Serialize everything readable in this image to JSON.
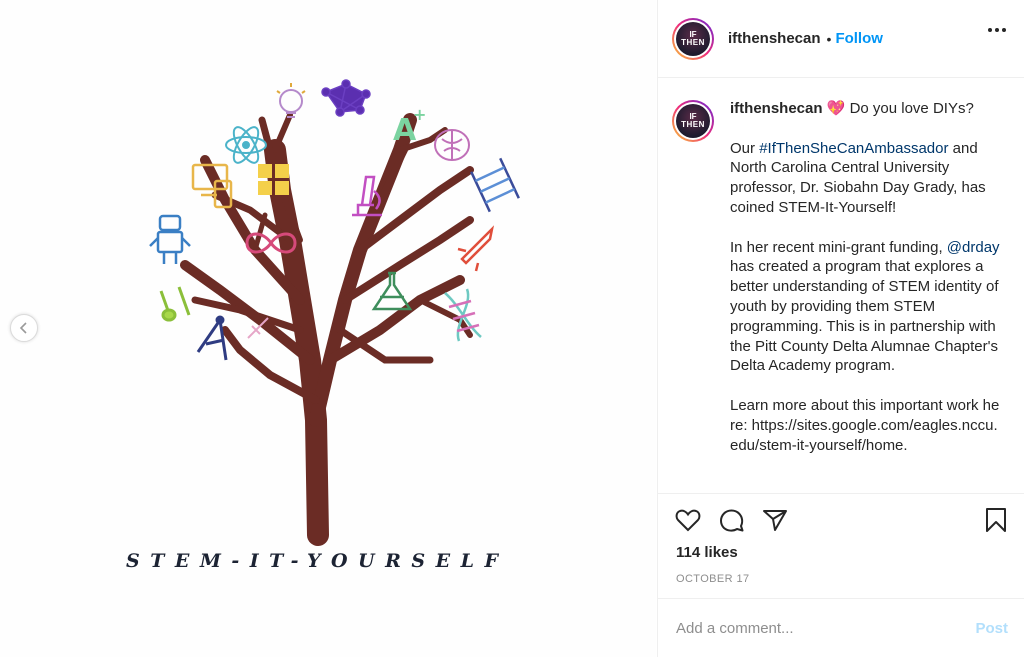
{
  "media": {
    "artwork_title": "STEM-IT-YOURSELF",
    "prev_icon": "chevron-left-icon",
    "icons": [
      "lightbulb-icon",
      "network-icon",
      "a-plus-icon",
      "brain-icon",
      "atom-icon",
      "devices-icon",
      "microscope-icon",
      "abacus-icon",
      "robot-icon",
      "infinity-icon",
      "rocket-icon",
      "flask-icon",
      "test-tubes-icon",
      "compass-icon",
      "dna-icon"
    ],
    "colors": {
      "trunk": "#6b2c25",
      "title": "#1c2333"
    }
  },
  "header": {
    "username": "ifthenshecan",
    "separator": "•",
    "follow_label": "Follow",
    "avatar_line1": "IF",
    "avatar_line2": "THEN",
    "more_icon": "more-horizontal-icon"
  },
  "post": {
    "username": "ifthenshecan",
    "emoji": "💖",
    "line1": "Do you love DIYs?",
    "p1_prefix": "Our ",
    "hashtag": "#IfThenSheCanAmbassador",
    "p1_suffix": " and North Carolina Central University professor, Dr. Siobahn Day Grady, has coined STEM-It-Yourself!",
    "p2_prefix": "In her recent mini-grant funding, ",
    "mention": "@drday",
    "p2_suffix": " has created a program that explores a better understanding of STEM identity of youth by providing them STEM programming. This is in partnership with the Pitt County Delta Alumnae Chapter's Delta Academy program.",
    "p3": "Learn more about this important work here: https://sites.google.com/eagles.nccu.edu/stem-it-yourself/home."
  },
  "actions": {
    "likes": "114 likes",
    "date": "OCTOBER 17",
    "icons": [
      "heart-icon",
      "comment-icon",
      "share-icon",
      "bookmark-icon"
    ]
  },
  "comment_box": {
    "placeholder": "Add a comment...",
    "post_label": "Post",
    "post_color": "#b2dffc"
  },
  "accent": "#0095f6"
}
